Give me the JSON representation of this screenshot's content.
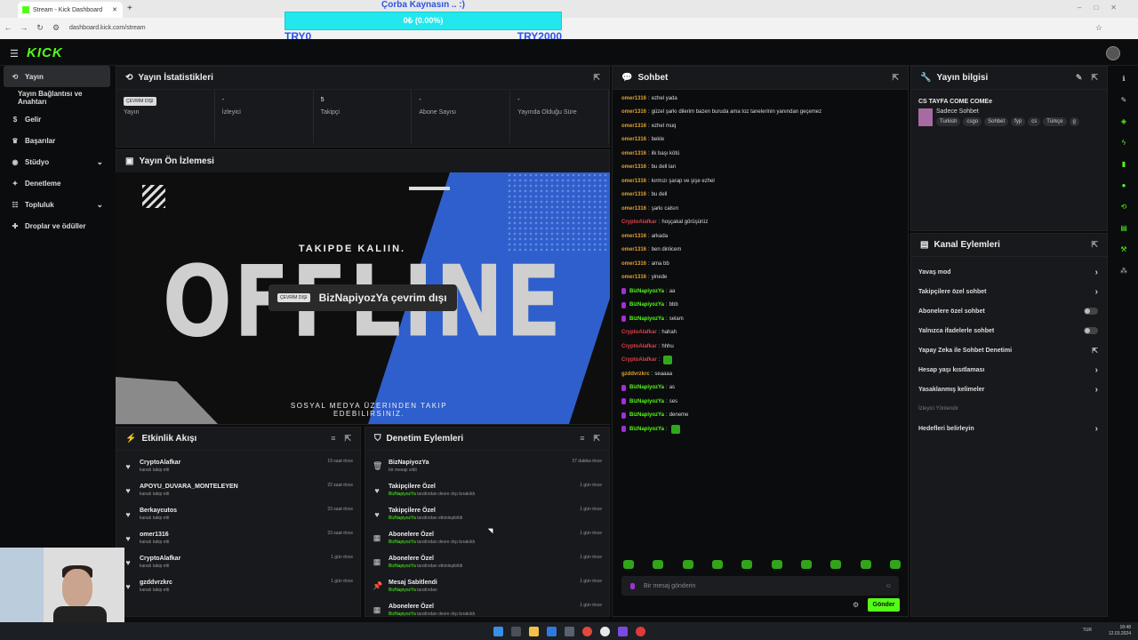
{
  "browser": {
    "tab_title": "Stream - Kick Dashboard",
    "url": "dashboard.kick.com/stream"
  },
  "donation": {
    "title": "Çorba Kaynasın .. :)",
    "progress_text": "0₺ (0.00%)",
    "progress_fraction": 0,
    "min_label": "TRY0",
    "max_label": "TRY2000"
  },
  "brand": {
    "logo": "KICK",
    "accent": "#53fc18"
  },
  "sidebar": {
    "items": [
      {
        "label": "Yayın",
        "icon": "signal-icon",
        "active": true
      },
      {
        "label": "Yayın Bağlantısı ve Anahtarı",
        "icon": "",
        "sub": true
      },
      {
        "label": "Gelir",
        "icon": "money-icon"
      },
      {
        "label": "Başarılar",
        "icon": "trophy-icon"
      },
      {
        "label": "Stüdyo",
        "icon": "studio-icon",
        "chevron": true
      },
      {
        "label": "Denetleme",
        "icon": "wrench-icon"
      },
      {
        "label": "Topluluk",
        "icon": "community-icon",
        "chevron": true
      },
      {
        "label": "Droplar ve ödüller",
        "icon": "gift-icon"
      }
    ]
  },
  "stats_panel": {
    "title": "Yayın İstatistikleri",
    "status_badge": "ÇEVRİM DIŞI",
    "stats": [
      {
        "value": "",
        "label": "Yayın"
      },
      {
        "value": "-",
        "label": "İzleyici"
      },
      {
        "value": "5",
        "label": "Takipçi"
      },
      {
        "value": "-",
        "label": "Abone Sayısı"
      },
      {
        "value": "-",
        "label": "Yayında Olduğu Süre"
      }
    ]
  },
  "preview_panel": {
    "title": "Yayın Ön İzlemesi",
    "takip": "TAKIPDE KALIIN.",
    "offline_word": "OFFLINE",
    "badge": "ÇEVRİM DIŞI",
    "pill_text": "BizNapiyozYa çevrim dışı",
    "social": "SOSYAL MEDYA ÜZERINDEN TAKIP EDEBILIRSINIZ."
  },
  "activity_feed": {
    "title": "Etkinlik Akışı",
    "rows": [
      {
        "name": "CryptoAlafkar",
        "sub": "kanalı takip etti",
        "time": "19 saat önce"
      },
      {
        "name": "APOYU_DUVARA_MONTELEYEN",
        "sub": "kanalı takip etti",
        "time": "22 saat önce"
      },
      {
        "name": "Berkaycutos",
        "sub": "kanalı takip etti",
        "time": "23 saat önce"
      },
      {
        "name": "omer1316",
        "sub": "kanalı takip etti",
        "time": "23 saat önce"
      },
      {
        "name": "CryptoAlafkar",
        "sub": "kanalı takip etti",
        "time": "1 gün önce"
      },
      {
        "name": "gzddvrzkrc",
        "sub": "kanalı takip etti",
        "time": "1 gün önce"
      }
    ]
  },
  "mod_actions": {
    "title": "Denetim Eylemleri",
    "rows": [
      {
        "icon": "trash-icon",
        "name": "BizNapiyozYa",
        "user": "",
        "sub": "bir mesajı sildi",
        "time": "37 dakika önce"
      },
      {
        "icon": "heart-icon",
        "name": "Takipçilere Özel",
        "user": "BizNapiyozYa",
        "sub": "tarafından devre dışı bırakıldı",
        "time": "1 gün önce"
      },
      {
        "icon": "heart-icon",
        "name": "Takipçilere Özel",
        "user": "BizNapiyozYa",
        "sub": "tarafından etkinleştirildi",
        "time": "1 gün önce"
      },
      {
        "icon": "gift-icon",
        "name": "Abonelere Özel",
        "user": "BizNapiyozYa",
        "sub": "tarafından devre dışı bırakıldı",
        "time": "1 gün önce"
      },
      {
        "icon": "gift-icon",
        "name": "Abonelere Özel",
        "user": "BizNapiyozYa",
        "sub": "tarafından etkinleştirildi",
        "time": "1 gün önce"
      },
      {
        "icon": "pin-icon",
        "name": "Mesaj Sabitlendi",
        "user": "BizNapiyozYa",
        "sub": "tarafından",
        "time": "1 gün önce"
      },
      {
        "icon": "gift-icon",
        "name": "Abonelere Özel",
        "user": "BizNapiyozYa",
        "sub": "tarafından devre dışı bırakıldı",
        "time": "1 gün önce"
      }
    ]
  },
  "chat": {
    "title": "Sohbet",
    "messages": [
      {
        "user": "omer1316",
        "color": "#e0a030",
        "text": "ezhel yada"
      },
      {
        "user": "omer1316",
        "color": "#e0a030",
        "text": "güzel şarkı dilerim bazen buruda ama toz tanelerinin yanından geçemez"
      },
      {
        "user": "omer1316",
        "color": "#e0a030",
        "text": "ezhel muq"
      },
      {
        "user": "omer1316",
        "color": "#e0a030",
        "text": "bekle"
      },
      {
        "user": "omer1316",
        "color": "#e0a030",
        "text": "ilk başı kötü"
      },
      {
        "user": "omer1316",
        "color": "#e0a030",
        "text": "bu dell ları"
      },
      {
        "user": "omer1316",
        "color": "#e0a030",
        "text": "kırmızı şarap ve şişe ezhel"
      },
      {
        "user": "omer1316",
        "color": "#e0a030",
        "text": "bu dell"
      },
      {
        "user": "omer1316",
        "color": "#e0a030",
        "text": "şarkı calsın"
      },
      {
        "user": "CryptoAlafkar",
        "color": "#e0404a",
        "text": "hoşçakal görüşürüz"
      },
      {
        "user": "omer1316",
        "color": "#e0a030",
        "text": "arkada"
      },
      {
        "user": "omer1316",
        "color": "#e0a030",
        "text": "ben dinlicem"
      },
      {
        "user": "omer1316",
        "color": "#e0a030",
        "text": "ama bb"
      },
      {
        "user": "omer1316",
        "color": "#e0a030",
        "text": "yinede"
      },
      {
        "user": "BizNapiyozYa",
        "color": "#53fc18",
        "text": "aa",
        "mic": true
      },
      {
        "user": "BizNapiyozYa",
        "color": "#53fc18",
        "text": "bbb",
        "mic": true
      },
      {
        "user": "BizNapiyozYa",
        "color": "#53fc18",
        "text": "selam",
        "mic": true
      },
      {
        "user": "CryptoAlafkar",
        "color": "#e0404a",
        "text": "hahah"
      },
      {
        "user": "CryptoAlafkar",
        "color": "#e0404a",
        "text": "hhhu"
      },
      {
        "user": "CryptoAlafkar",
        "color": "#e0404a",
        "text": "",
        "emote": true
      },
      {
        "user": "gzddvrzkrc",
        "color": "#e0a030",
        "text": "seaaaa"
      },
      {
        "user": "BizNapiyozYa",
        "color": "#53fc18",
        "text": "as",
        "mic": true
      },
      {
        "user": "BizNapiyozYa",
        "color": "#53fc18",
        "text": "ses",
        "mic": true
      },
      {
        "user": "BizNapiyozYa",
        "color": "#53fc18",
        "text": "deneme",
        "mic": true
      },
      {
        "user": "BizNapiyozYa",
        "color": "#53fc18",
        "text": "",
        "mic": true,
        "emote": true
      }
    ],
    "input_placeholder": "Bir mesaj gönderin",
    "send_label": "Gönder"
  },
  "stream_info": {
    "title": "Yayın bilgisi",
    "stream_title": "CS TAYFA COME COMEe",
    "category": "Sadece Sohbet",
    "tags": [
      "Turkish",
      "csgo",
      "Sohbet",
      "fyp",
      "cs",
      "Türkçe",
      "g"
    ]
  },
  "channel_actions": {
    "title": "Kanal Eylemleri",
    "rows": [
      {
        "label": "Yavaş mod",
        "control": "chevron"
      },
      {
        "label": "Takipçilere özel sohbet",
        "control": "chevron"
      },
      {
        "label": "Abonelere özel sohbet",
        "control": "toggle"
      },
      {
        "label": "Yalnızca ifadelerle sohbet",
        "control": "toggle"
      },
      {
        "label": "Yapay Zeka ile Sohbet Denetimi",
        "control": "external"
      },
      {
        "label": "Hesap yaşı kısıtlaması",
        "control": "chevron"
      },
      {
        "label": "Yasaklanmış kelimeler",
        "control": "chevron"
      },
      {
        "label": "İzleyici Yönlendir",
        "control": "none",
        "muted": true
      },
      {
        "label": "Hedefleri belirleyin",
        "control": "chevron"
      }
    ]
  },
  "taskbar": {
    "lang": "TUR",
    "time": "18:48",
    "date": "12.03.2024"
  }
}
